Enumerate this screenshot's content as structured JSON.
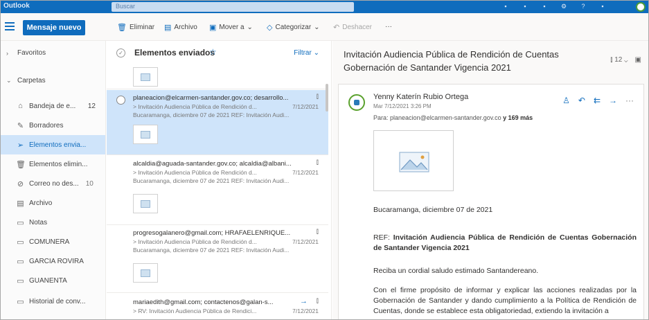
{
  "topbar": {
    "brand": "Outlook",
    "search_placeholder": "Buscar"
  },
  "commands": {
    "new_mail": "Mensaje nuevo",
    "delete": "Eliminar",
    "archive": "Archivo",
    "move_to": "Mover a",
    "categorize": "Categorizar",
    "undo": "Deshacer",
    "more": "···"
  },
  "nav": {
    "favorites": "Favoritos",
    "folders": "Carpetas",
    "items": [
      {
        "label": "Bandeja de e...",
        "count": "12"
      },
      {
        "label": "Borradores",
        "count": ""
      },
      {
        "label": "Elementos envia...",
        "count": ""
      },
      {
        "label": "Elementos elimin...",
        "count": ""
      },
      {
        "label": "Correo no des...",
        "count": "10"
      },
      {
        "label": "Archivo",
        "count": ""
      },
      {
        "label": "Notas",
        "count": ""
      },
      {
        "label": "COMUNERA",
        "count": ""
      },
      {
        "label": "GARCIA ROVIRA",
        "count": ""
      },
      {
        "label": "GUANENTA",
        "count": ""
      },
      {
        "label": "Historial de conv...",
        "count": ""
      }
    ]
  },
  "list": {
    "title": "Elementos enviados",
    "filter": "Filtrar",
    "messages": [
      {
        "line1": "planeacion@elcarmen-santander.gov.co; desarrollo...",
        "line2": "> Invitación Audiencia Pública de Rendición d...",
        "date": "7/12/2021",
        "line3": "Bucaramanga, diciembre 07 de 2021 REF: Invitación Audi..."
      },
      {
        "line1": "alcaldia@aguada-santander.gov.co; alcaldia@albani...",
        "line2": "> Invitación Audiencia Pública de Rendición d...",
        "date": "7/12/2021",
        "line3": "Bucaramanga, diciembre 07 de 2021 REF: Invitación Audi..."
      },
      {
        "line1": "progresogalanero@gmail.com; HRAFAELENRIQUE...",
        "line2": "> Invitación Audiencia Pública de Rendición d...",
        "date": "7/12/2021",
        "line3": "Bucaramanga, diciembre 07 de 2021 REF: Invitación Audi..."
      },
      {
        "line1": "mariaedith@gmail.com; contactenos@galan-s...",
        "line2": "> RV: Invitación Audiencia Pública de Rendici...",
        "date": "7/12/2021",
        "line3": ""
      }
    ]
  },
  "reading": {
    "subject": "Invitación Audiencia Pública de Rendición de Cuentas Gobernación de Santander Vigencia 2021",
    "zoom": "12",
    "sender": "Yenny Katerín Rubio Ortega",
    "sent": "Mar 7/12/2021 3:26 PM",
    "to_label": "Para:",
    "to_address": "planeacion@elcarmen-santander.gov.co",
    "to_more": "y 169 más",
    "date_line": "Bucaramanga, diciembre 07 de 2021",
    "ref_prefix": "REF:",
    "ref_text": "Invitación Audiencia Pública de Rendición de Cuentas Gobernación de Santander Vigencia 2021",
    "greeting": "Reciba un cordial saludo estimado Santandereano.",
    "paragraph": "Con el firme propósito de informar y explicar las acciones realizadas por la Gobernación de Santander y dando cumplimiento a la Política de Rendición de Cuentas, donde se establece esta obligatoriedad, extiendo la invitación a"
  }
}
